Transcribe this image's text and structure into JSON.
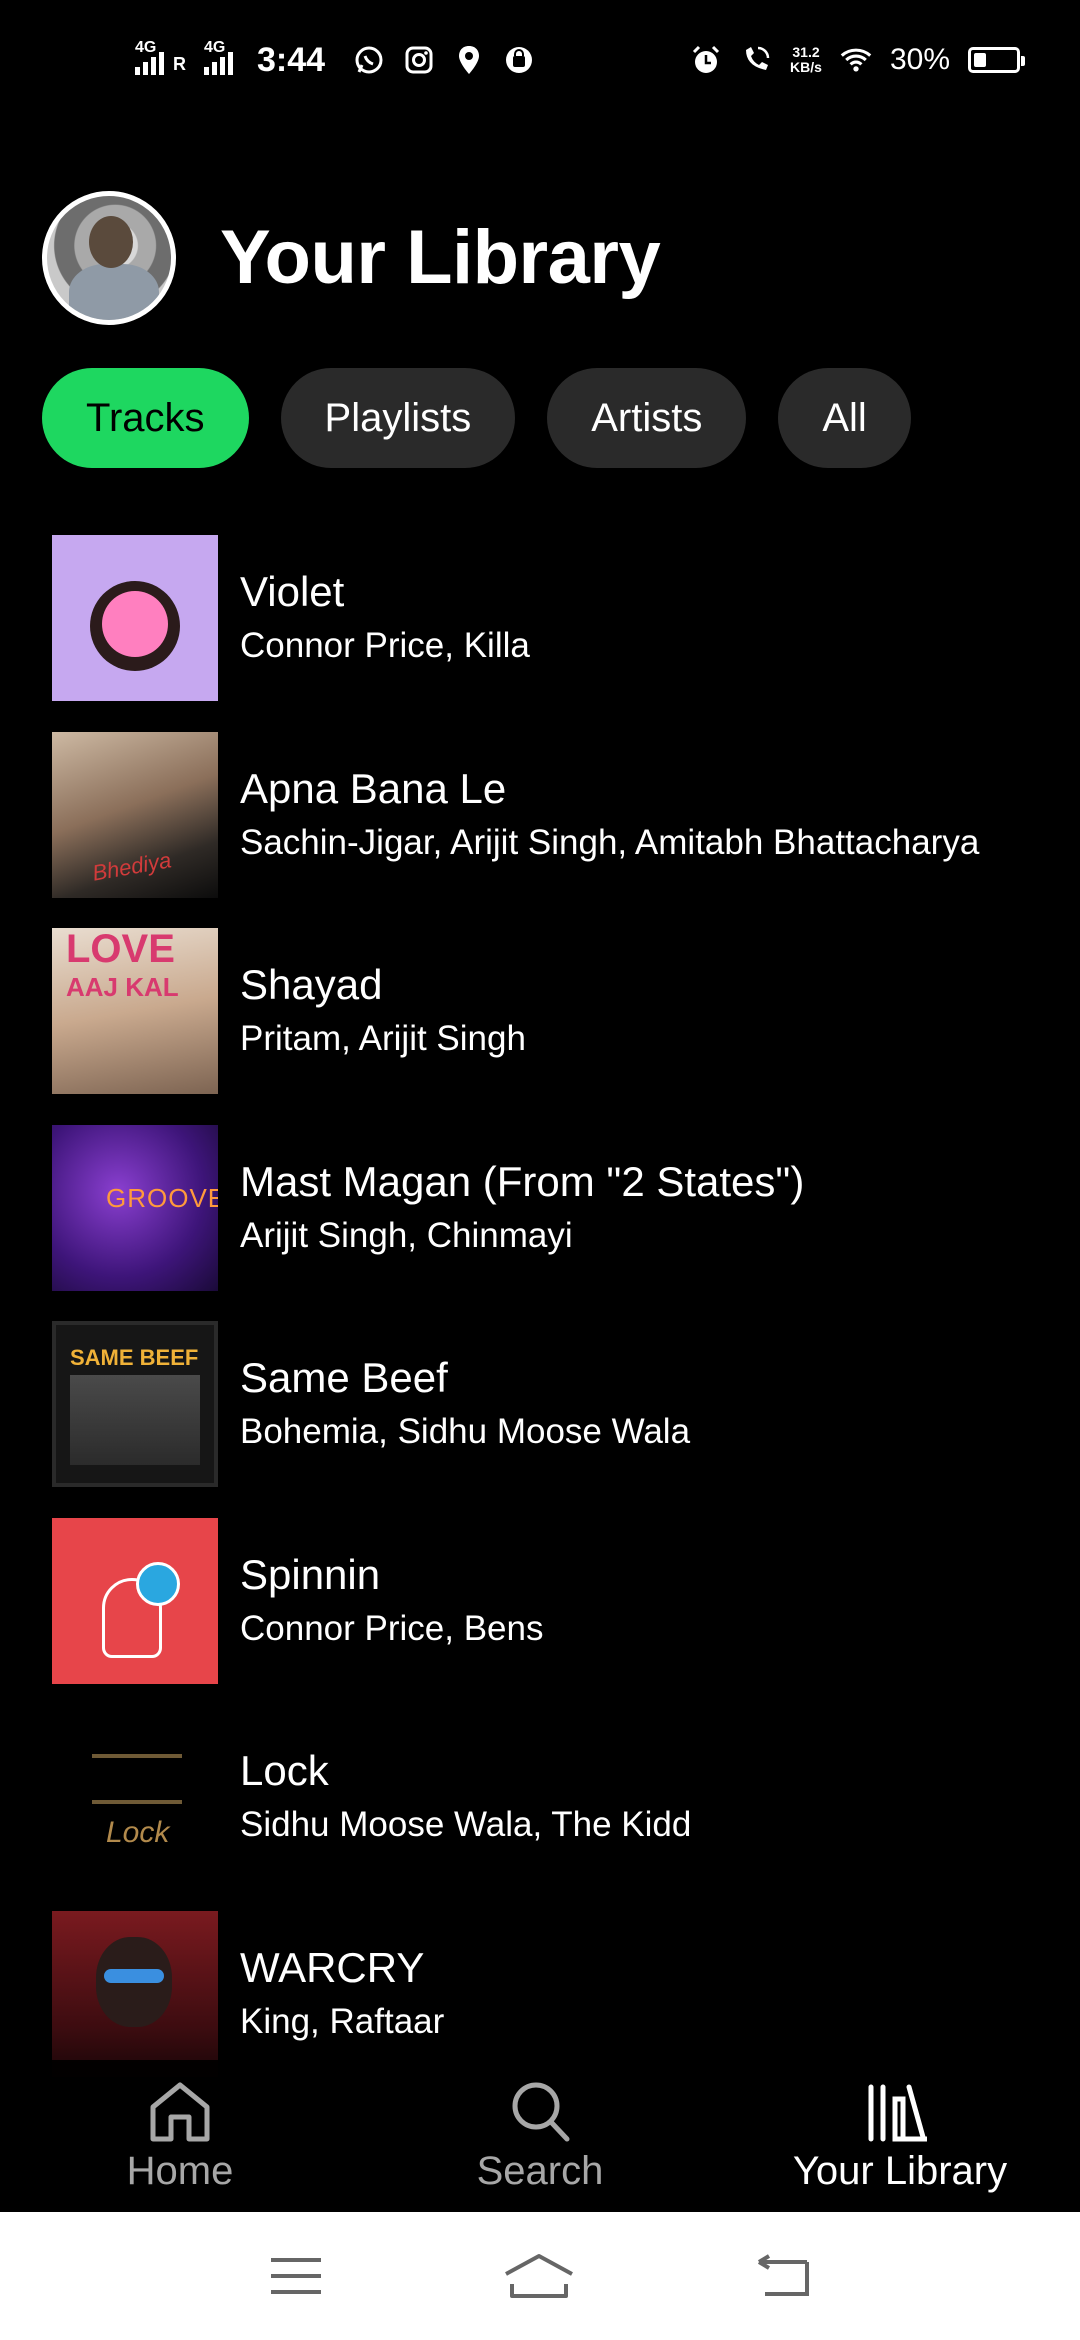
{
  "status_bar": {
    "network_1": "4G",
    "roaming": "R",
    "network_2": "4G",
    "time": "3:44",
    "speed_value": "31.2",
    "speed_unit": "KB/s",
    "battery_pct": "30%"
  },
  "header": {
    "title": "Your Library"
  },
  "filters": [
    {
      "label": "Tracks",
      "active": true
    },
    {
      "label": "Playlists",
      "active": false
    },
    {
      "label": "Artists",
      "active": false
    },
    {
      "label": "All",
      "active": false
    }
  ],
  "tracks": [
    {
      "title": "Violet",
      "artists": "Connor Price, Killa"
    },
    {
      "title": "Apna Bana Le",
      "artists": "Sachin-Jigar, Arijit Singh, Amitabh Bhattacharya"
    },
    {
      "title": "Shayad",
      "artists": "Pritam, Arijit Singh"
    },
    {
      "title": "Mast Magan (From \"2 States\")",
      "artists": "Arijit Singh, Chinmayi"
    },
    {
      "title": "Same Beef",
      "artists": "Bohemia, Sidhu Moose Wala"
    },
    {
      "title": "Spinnin",
      "artists": "Connor Price, Bens"
    },
    {
      "title": "Lock",
      "artists": "Sidhu Moose Wala, The Kidd"
    },
    {
      "title": "WARCRY",
      "artists": "King, Raftaar"
    }
  ],
  "album_art_text": {
    "apna": "Bhediya",
    "shayad_1": "LOVE",
    "shayad_2": "AAJ KAL",
    "mast": "GROOVE",
    "beef": "SAME BEEF",
    "lock": "Lock"
  },
  "bottom_nav": {
    "home": "Home",
    "search": "Search",
    "library": "Your Library"
  },
  "colors": {
    "accent": "#1ed760",
    "background": "#000000",
    "chip": "#2a2a2a",
    "inactive_nav": "#a7a7a7"
  }
}
